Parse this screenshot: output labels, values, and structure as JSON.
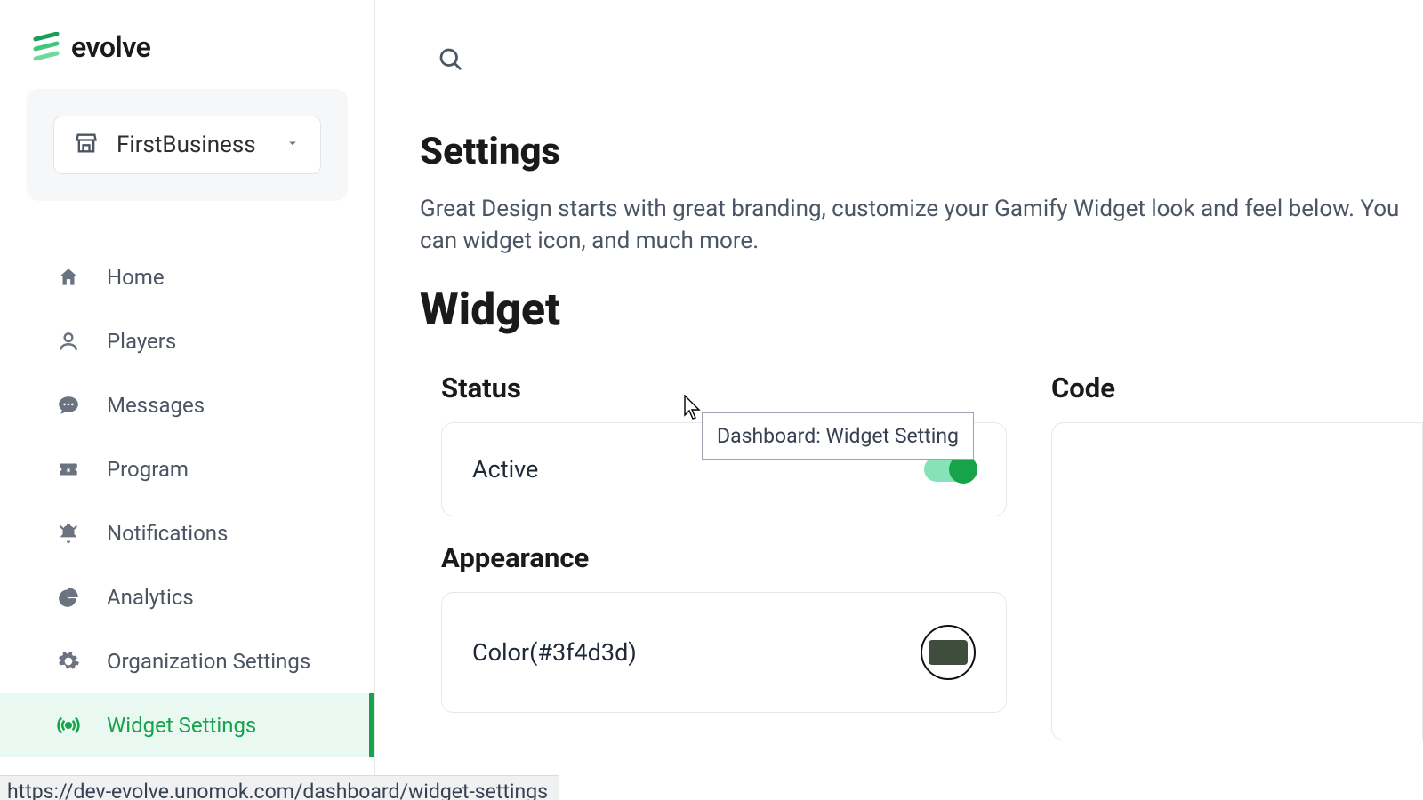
{
  "brand": {
    "name": "evolve"
  },
  "org": {
    "selected": "FirstBusiness"
  },
  "nav": {
    "home": "Home",
    "players": "Players",
    "messages": "Messages",
    "program": "Program",
    "notifications": "Notifications",
    "analytics": "Analytics",
    "org_settings": "Organization Settings",
    "widget_settings": "Widget Settings"
  },
  "page": {
    "title": "Settings",
    "description": "Great Design starts with great branding, customize your Gamify Widget look and feel below. You can widget icon, and much more.",
    "widget_heading": "Widget",
    "status_heading": "Status",
    "active_label": "Active",
    "active_value": true,
    "appearance_heading": "Appearance",
    "color_label": "Color(#3f4d3d)",
    "color_value": "#3f4d3d",
    "code_heading": "Code"
  },
  "tooltip": "Dashboard: Widget Setting",
  "status_bar_url": "https://dev-evolve.unomok.com/dashboard/widget-settings"
}
